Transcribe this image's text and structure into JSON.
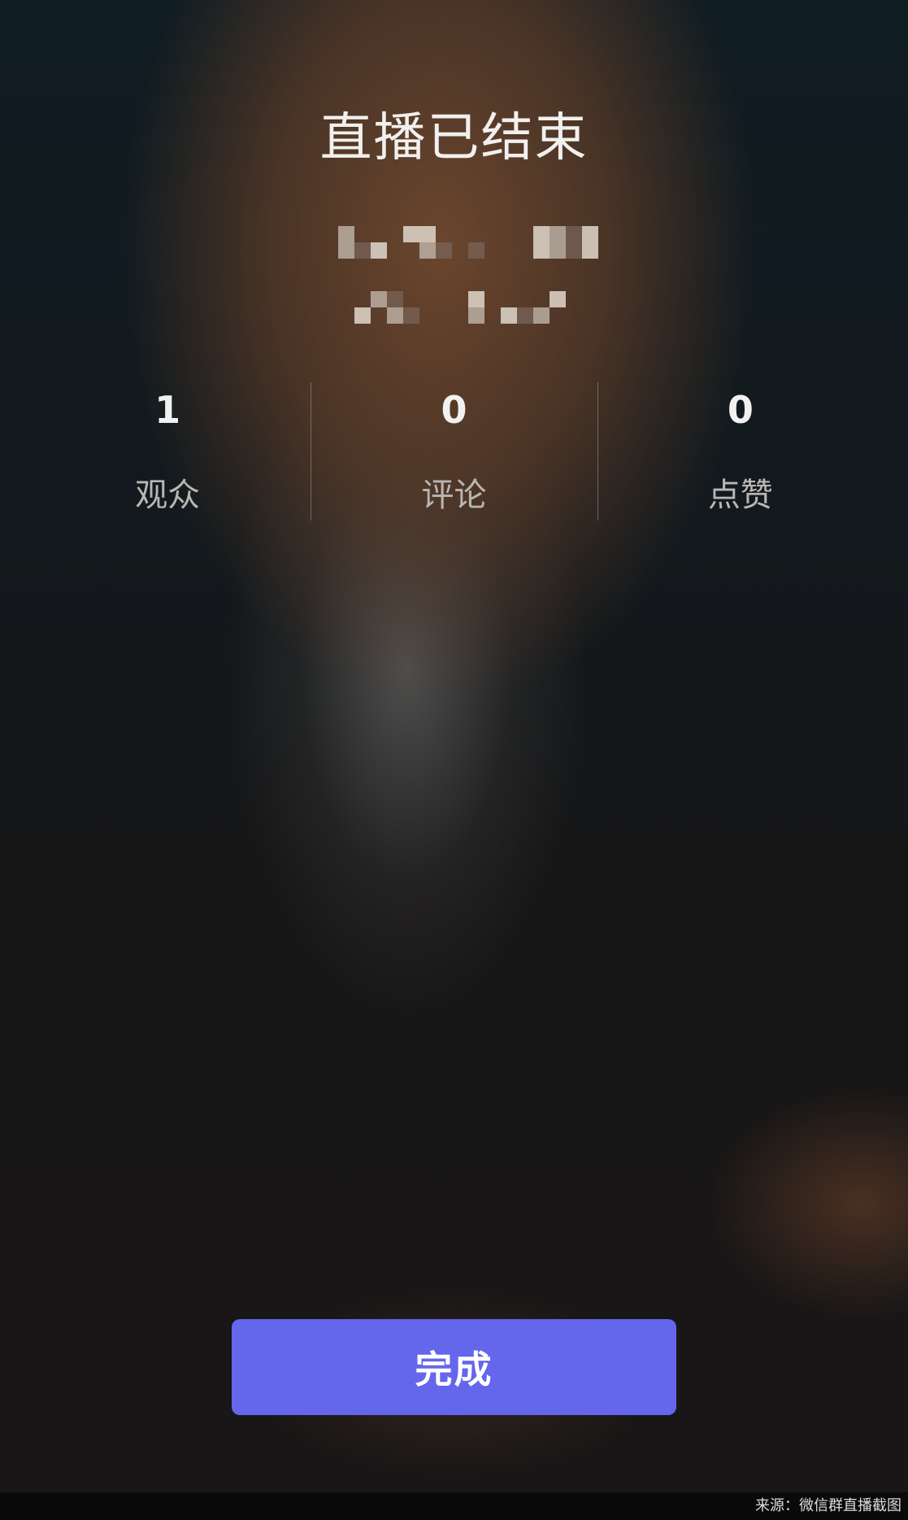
{
  "app": {
    "title": "直播已结束"
  },
  "host": {
    "name_obscured": true
  },
  "stats": [
    {
      "value": "1",
      "label": "观众"
    },
    {
      "value": "0",
      "label": "评论"
    },
    {
      "value": "0",
      "label": "点赞"
    }
  ],
  "actions": {
    "done_label": "完成"
  },
  "footer": {
    "source_text": "来源：微信群直播截图"
  },
  "colors": {
    "accent": "#6466ec",
    "title_text": "#f2f0ee",
    "label_text": "#b9b6b3"
  }
}
